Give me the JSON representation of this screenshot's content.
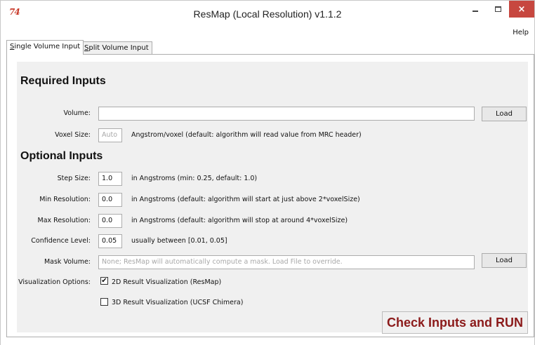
{
  "window": {
    "app_icon": "74",
    "title": "ResMap (Local Resolution) v1.1.2",
    "close_glyph": "×"
  },
  "menu": {
    "help": "Help"
  },
  "tabs": {
    "single": {
      "underline": "S",
      "rest": "ingle Volume Input"
    },
    "split": {
      "underline": "S",
      "rest": "plit Volume Input"
    }
  },
  "required": {
    "heading": "Required Inputs",
    "volume_label": "Volume:",
    "volume_value": "",
    "volume_load": "Load",
    "voxel_label": "Voxel Size:",
    "voxel_placeholder": "Auto",
    "voxel_hint": "Angstrom/voxel (default: algorithm will read value from MRC header)"
  },
  "optional": {
    "heading": "Optional Inputs",
    "step_label": "Step Size:",
    "step_value": "1.0",
    "step_hint": "in Angstroms (min: 0.25, default: 1.0)",
    "minres_label": "Min Resolution:",
    "minres_value": "0.0",
    "minres_hint": "in Angstroms (default: algorithm will start at just above 2*voxelSize)",
    "maxres_label": "Max Resolution:",
    "maxres_value": "0.0",
    "maxres_hint": "in Angstroms (default: algorithm will stop at around 4*voxelSize)",
    "conf_label": "Confidence Level:",
    "conf_value": "0.05",
    "conf_hint": "usually between [0.01, 0.05]",
    "mask_label": "Mask Volume:",
    "mask_placeholder": "None; ResMap will automatically compute a mask. Load File to override.",
    "mask_load": "Load",
    "vis_label": "Visualization Options:",
    "vis_2d": "2D Result Visualization (ResMap)",
    "vis_2d_checked": true,
    "vis_3d": "3D Result Visualization (UCSF Chimera)",
    "vis_3d_checked": false
  },
  "run_button": "Check Inputs and RUN",
  "colors": {
    "close_button": "#c7473f",
    "run_text": "#8b1a1a",
    "app_icon": "#c83a2a"
  }
}
